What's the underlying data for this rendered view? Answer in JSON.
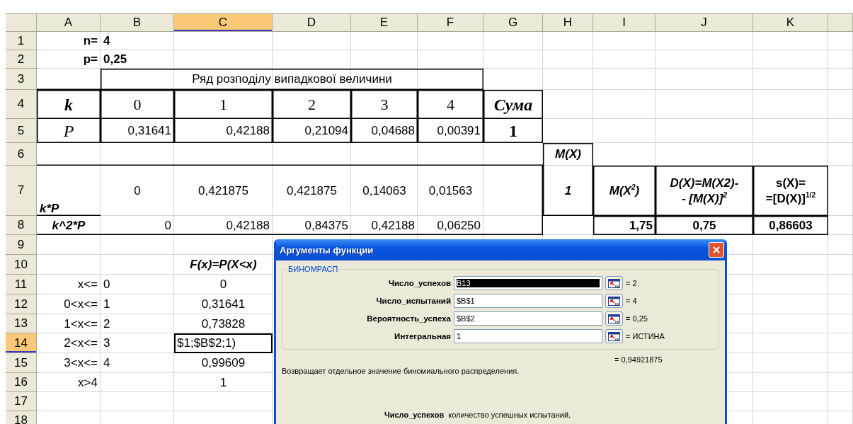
{
  "columns": [
    {
      "label": "A",
      "selected": false
    },
    {
      "label": "B",
      "selected": false
    },
    {
      "label": "C",
      "selected": true
    },
    {
      "label": "D",
      "selected": false
    },
    {
      "label": "E",
      "selected": false
    },
    {
      "label": "F",
      "selected": false
    },
    {
      "label": "G",
      "selected": false
    },
    {
      "label": "H",
      "selected": false
    },
    {
      "label": "I",
      "selected": false
    },
    {
      "label": "J",
      "selected": false
    },
    {
      "label": "K",
      "selected": false
    }
  ],
  "rows": [
    {
      "label": "1",
      "selected": false,
      "cells": {
        "A": {
          "text": "n=",
          "kind": "bold"
        },
        "B": {
          "text": "4",
          "kind": "bold"
        }
      }
    },
    {
      "label": "2",
      "selected": false,
      "cells": {
        "A": {
          "text": "p=",
          "kind": "bold"
        },
        "B": {
          "text": "0,25",
          "kind": "bold"
        }
      }
    },
    {
      "label": "3",
      "selected": false,
      "cells": {
        "B": {
          "text": "Ряд розподілу випадкової величини",
          "kind": "plain"
        }
      }
    },
    {
      "label": "4",
      "selected": false,
      "cells": {
        "A": {
          "text": "k",
          "kind": "serif-bold-italic"
        },
        "B": {
          "text": "0",
          "kind": "serif"
        },
        "C": {
          "text": "1",
          "kind": "serif"
        },
        "D": {
          "text": "2",
          "kind": "serif"
        },
        "E": {
          "text": "3",
          "kind": "serif"
        },
        "F": {
          "text": "4",
          "kind": "serif"
        },
        "G": {
          "text": "Сума",
          "kind": "serif-bold-italic"
        }
      }
    },
    {
      "label": "5",
      "selected": false,
      "cells": {
        "A": {
          "text": "P",
          "kind": "serif-italic"
        },
        "B": {
          "text": "0,31641",
          "kind": "plain"
        },
        "C": {
          "text": "0,42188",
          "kind": "plain"
        },
        "D": {
          "text": "0,21094",
          "kind": "plain"
        },
        "E": {
          "text": "0,04688",
          "kind": "plain"
        },
        "F": {
          "text": "0,00391",
          "kind": "plain"
        },
        "G": {
          "text": "1",
          "kind": "serif-bold"
        }
      }
    },
    {
      "label": "6",
      "selected": false,
      "cells": {
        "H": {
          "text": "M(X)",
          "kind": "bold-italic"
        }
      }
    },
    {
      "label": "7",
      "selected": false,
      "cells": {
        "A": {
          "text": "k*P",
          "kind": "bold-italic"
        },
        "B": {
          "text": "0",
          "kind": "plain"
        },
        "C": {
          "text": "0,421875",
          "kind": "plain"
        },
        "D": {
          "text": "0,421875",
          "kind": "plain"
        },
        "E": {
          "text": "0,14063",
          "kind": "plain"
        },
        "F": {
          "text": "0,01563",
          "kind": "plain"
        },
        "H": {
          "text": "1",
          "kind": "bold-italic"
        },
        "I": {
          "text": "M(X$^{2}$)",
          "kind": "bold-italic"
        },
        "J": {
          "text": "D(X)=M(X2)-\n- [M(X)]$^{2}$",
          "kind": "bold-italic"
        },
        "K": {
          "text": "s(X)=\n=[D(X)]$^{1/2}$",
          "kind": "bold"
        }
      }
    },
    {
      "label": "8",
      "selected": false,
      "cells": {
        "A": {
          "text": "k^2*P",
          "kind": "bold-italic"
        },
        "B": {
          "text": "0",
          "kind": "plain"
        },
        "C": {
          "text": "0,42188",
          "kind": "plain"
        },
        "D": {
          "text": "0,84375",
          "kind": "plain"
        },
        "E": {
          "text": "0,42188",
          "kind": "plain"
        },
        "F": {
          "text": "0,06250",
          "kind": "plain"
        },
        "I": {
          "text": "1,75",
          "kind": "bold"
        },
        "J": {
          "text": "0,75",
          "kind": "bold"
        },
        "K": {
          "text": "0,86603",
          "kind": "bold"
        }
      }
    },
    {
      "label": "9",
      "selected": false,
      "cells": {}
    },
    {
      "label": "10",
      "selected": false,
      "cells": {
        "C": {
          "text": "F(x)=P(X<x)",
          "kind": "bold-italic"
        }
      }
    },
    {
      "label": "11",
      "selected": false,
      "cells": {
        "A": {
          "text": "x<=",
          "kind": "plain"
        },
        "B": {
          "text": "0",
          "kind": "plain"
        },
        "C": {
          "text": "0",
          "kind": "plain"
        }
      }
    },
    {
      "label": "12",
      "selected": false,
      "cells": {
        "A": {
          "text": "0<x<=",
          "kind": "plain"
        },
        "B": {
          "text": "1",
          "kind": "plain"
        },
        "C": {
          "text": "0,31641",
          "kind": "plain"
        }
      }
    },
    {
      "label": "13",
      "selected": false,
      "cells": {
        "A": {
          "text": "1<x<=",
          "kind": "plain"
        },
        "B": {
          "text": "2",
          "kind": "plain"
        },
        "C": {
          "text": "0,73828",
          "kind": "plain"
        }
      }
    },
    {
      "label": "14",
      "selected": true,
      "cells": {
        "A": {
          "text": "2<x<=",
          "kind": "plain"
        },
        "B": {
          "text": "3",
          "kind": "plain"
        },
        "C": {
          "text": "$1;$B$2;1)",
          "kind": "plain",
          "selected": true
        }
      }
    },
    {
      "label": "15",
      "selected": false,
      "cells": {
        "A": {
          "text": "3<x<=",
          "kind": "plain"
        },
        "B": {
          "text": "4",
          "kind": "plain"
        },
        "C": {
          "text": "0,99609",
          "kind": "plain"
        }
      }
    },
    {
      "label": "16",
      "selected": false,
      "cells": {
        "A": {
          "text": "x>4",
          "kind": "plain"
        },
        "C": {
          "text": "1",
          "kind": "plain"
        }
      }
    },
    {
      "label": "17",
      "selected": false,
      "cells": {}
    },
    {
      "label": "18",
      "selected": false,
      "cells": {}
    }
  ],
  "dialog": {
    "title": "Аргументы функции",
    "group_label": "БИНОМРАСП",
    "arguments": [
      {
        "label": "Число_успехов",
        "value": "B13",
        "result": "= 2",
        "highlighted": true
      },
      {
        "label": "Число_испытаний",
        "value": "$B$1",
        "result": "= 4",
        "highlighted": false
      },
      {
        "label": "Вероятность_успеха",
        "value": "$B$2",
        "result": "= 0,25",
        "highlighted": false
      },
      {
        "label": "Интегральная",
        "value": "1",
        "result": "= ИСТИНА",
        "highlighted": false
      }
    ],
    "result": "= 0,94921875",
    "description": "Возвращает отдельное значение биномиального распределения.",
    "help_name": "Число_успехов",
    "help_text": "количество успешных испытаний."
  }
}
